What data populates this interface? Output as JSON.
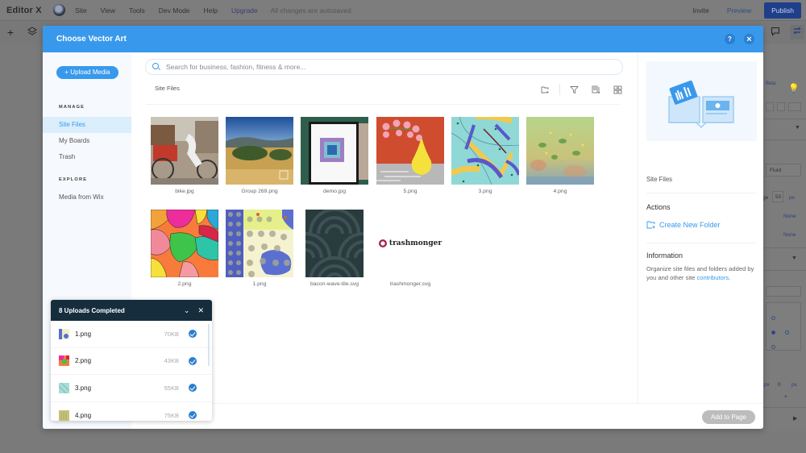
{
  "editor": {
    "logo": "Editor X",
    "menu": [
      "Site",
      "View",
      "Tools",
      "Dev Mode",
      "Help"
    ],
    "upgrade": "Upgrade",
    "autosave_status": "All changes are autosaved",
    "invite": "Invite",
    "preview": "Preview",
    "publish": "Publish"
  },
  "right_panel": {
    "beta_badge": "Beta",
    "fluid_label": "Fluid",
    "value_50": "50",
    "unit_px": "px",
    "none_1": "None",
    "none_2": "None",
    "unit_px2": "px",
    "value_0": "0",
    "unit_px3": "px"
  },
  "modal": {
    "title": "Choose Vector Art",
    "help_icon": "?",
    "close_icon": "×",
    "upload_button": "+ Upload Media",
    "nav": {
      "manage_heading": "MANAGE",
      "explore_heading": "EXPLORE",
      "items": [
        {
          "label": "Site Files",
          "active": true
        },
        {
          "label": "My Boards",
          "active": false
        },
        {
          "label": "Trash",
          "active": false
        },
        {
          "label": "Media from Wix",
          "active": false
        }
      ]
    },
    "search": {
      "placeholder": "Search for business, fashion, fitness & more...",
      "value": ""
    },
    "breadcrumb": "Site Files",
    "toolbar_icons": [
      "new-folder-icon",
      "filter-icon",
      "sort-icon",
      "grid-view-icon"
    ],
    "files": [
      {
        "name": "bike.jpg"
      },
      {
        "name": "Group 269.png"
      },
      {
        "name": "demo.jpg"
      },
      {
        "name": "5.png"
      },
      {
        "name": "3.png"
      },
      {
        "name": "4.png"
      },
      {
        "name": "2.png"
      },
      {
        "name": "1.png"
      },
      {
        "name": "bacon-wave-tile.svg"
      },
      {
        "name": "trashmonger.svg",
        "logo_text": "trashmonger"
      }
    ],
    "info": {
      "title": "Site Files",
      "actions_heading": "Actions",
      "create_folder": "Create New Folder",
      "information_heading": "Information",
      "information_text": "Organize site files and folders added by you and other site ",
      "information_link": "contributors",
      "information_end": "."
    },
    "add_to_page": "Add to Page"
  },
  "uploads": {
    "title": "8 Uploads Completed",
    "items": [
      {
        "name": "1.png",
        "size": "70KB",
        "done": true
      },
      {
        "name": "2.png",
        "size": "43KB",
        "done": true
      },
      {
        "name": "3.png",
        "size": "55KB",
        "done": true
      },
      {
        "name": "4.png",
        "size": "75KB",
        "done": true
      }
    ]
  },
  "colors": {
    "accent": "#3899ec",
    "uploads_header": "#162d3d",
    "publish": "#1f3f8a"
  }
}
